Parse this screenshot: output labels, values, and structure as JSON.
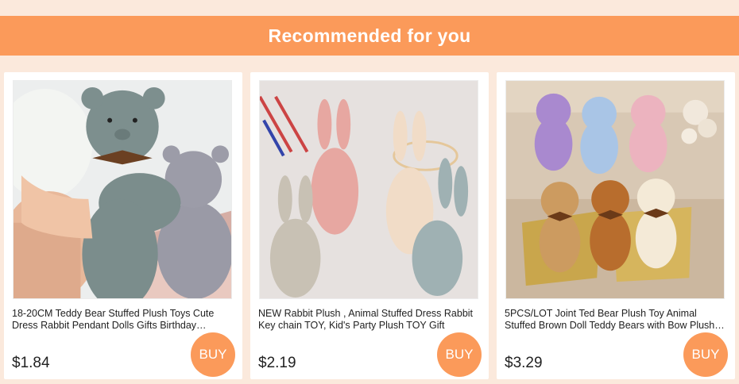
{
  "header": {
    "title": "Recommended for you"
  },
  "products": [
    {
      "title": "18-20CM Teddy Bear Stuffed Plush Toys Cute Dress Rabbit Pendant Dolls Gifts Birthday Wedding Party Decor",
      "price": "$1.84",
      "buy_label": "BUY",
      "image": "grey-knit-teddy-bears"
    },
    {
      "title": "NEW Rabbit Plush , Animal Stuffed Dress Rabbit Key chain TOY, Kid's Party Plush TOY Gift",
      "price": "$2.19",
      "buy_label": "BUY",
      "image": "linen-rabbit-plush-dolls"
    },
    {
      "title": "5PCS/LOT Joint Ted Bear Plush Toy Animal Stuffed Brown Doll Teddy Bears with Bow Plush Toys",
      "price": "$3.29",
      "buy_label": "BUY",
      "image": "colorful-mini-teddy-bears"
    }
  ],
  "colors": {
    "accent": "#fb9a5a",
    "background": "#fbe9dc",
    "card": "#ffffff"
  }
}
